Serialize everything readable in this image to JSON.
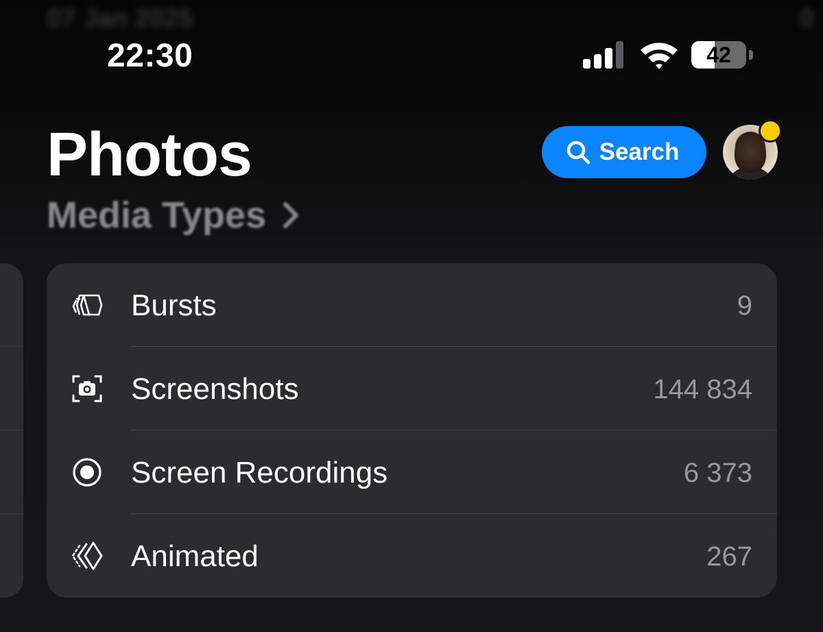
{
  "background_text": {
    "left": "07 Jan 2025",
    "right": "0"
  },
  "status_bar": {
    "time": "22:30",
    "signal_bars_active": 3,
    "signal_bars_total": 4,
    "wifi": "wifi-icon",
    "battery_percent": "42",
    "battery_level": 0.42
  },
  "header": {
    "title": "Photos",
    "subtitle": "Media Types",
    "search_label": "Search",
    "avatar_has_notification": true
  },
  "colors": {
    "accent": "#0a84ff",
    "notification": "#ffcc00",
    "card_background": "#2c2c2e",
    "secondary_text": "#98989d"
  },
  "media_types": [
    {
      "icon": "bursts-icon",
      "label": "Bursts",
      "count": "9"
    },
    {
      "icon": "screenshot-icon",
      "label": "Screenshots",
      "count": "144 834"
    },
    {
      "icon": "screen-recording-icon",
      "label": "Screen Recordings",
      "count": "6 373"
    },
    {
      "icon": "animated-icon",
      "label": "Animated",
      "count": "267"
    }
  ]
}
